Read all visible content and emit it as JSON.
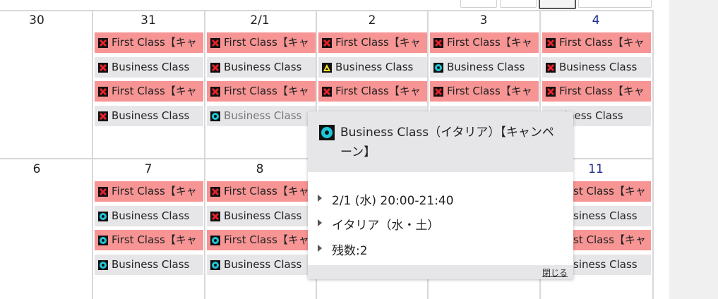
{
  "calendar": {
    "week1": {
      "days": [
        "30",
        "31",
        "2/1",
        "2",
        "3",
        "4"
      ],
      "events": {
        "d31": [
          "First Class【キャ",
          "Business Class",
          "First Class【キャ",
          "Business Class"
        ],
        "d0201": [
          "First Class【キャ",
          "Business Class",
          "First Class【キャ",
          "Business Class"
        ],
        "d2": [
          "First Class【キャ",
          "Business Class",
          "First Class【キャ"
        ],
        "d3": [
          "First Class【キャ",
          "Business Class",
          "First Class【キャ"
        ],
        "d4": [
          "First Class【キャ",
          "Business Class",
          "First Class【キャ",
          "siness Class"
        ]
      }
    },
    "week2": {
      "days": [
        "6",
        "7",
        "8",
        "11"
      ],
      "events": {
        "d7": [
          "First Class【キャ",
          "Business Class",
          "First Class【キャ",
          "Business Class"
        ],
        "d8": [
          "First Class【キャ",
          "Business Class",
          "First Class【キャ",
          "Business Class"
        ],
        "d11": [
          "st Class【キャ",
          "siness Class",
          "st Class【キャ",
          "siness Class"
        ]
      }
    }
  },
  "popup": {
    "title": "Business Class（イタリア）【キャンペーン】",
    "datetime": "2/1 (水) 20:00-21:40",
    "location": "イタリア（水・土）",
    "remaining": "残数:2",
    "close_label": "閉じる"
  },
  "colors": {
    "first_class_bg": "#f79494",
    "business_class_bg": "#e6e6e8",
    "saturday_text": "#1a2b8c",
    "available_marker": "#1ec8d8",
    "few_left_marker": "#f6e21c",
    "full_marker": "#e8202a"
  },
  "icons": {
    "full": "cross-mark-icon",
    "available": "circle-mark-icon",
    "few_left": "triangle-mark-icon"
  }
}
